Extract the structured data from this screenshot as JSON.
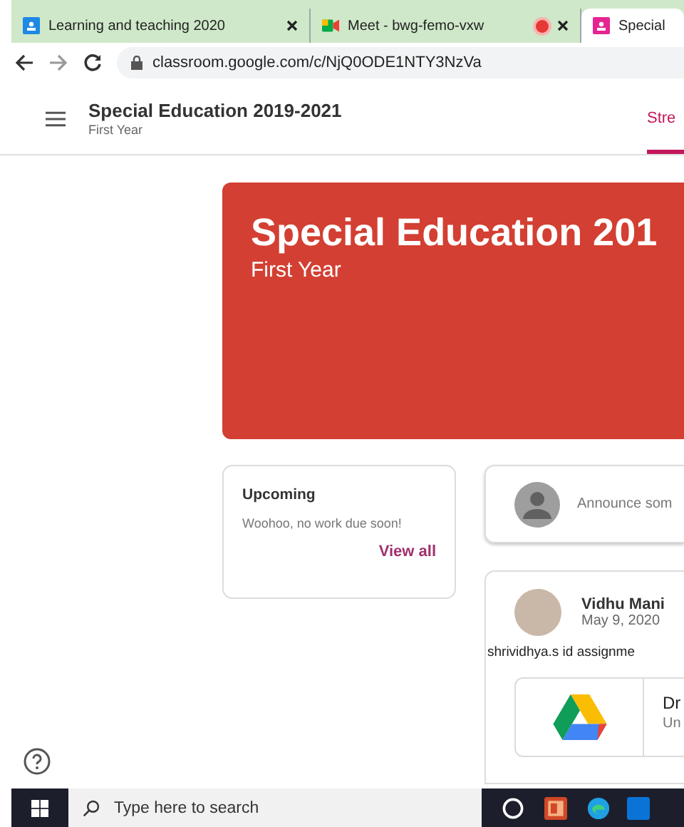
{
  "browser": {
    "tabs": [
      {
        "title": "Learning and teaching 2020",
        "selected": false,
        "recording": false
      },
      {
        "title": "Meet - bwg-femo-vxw",
        "selected": false,
        "recording": true
      },
      {
        "title": "Special",
        "selected": true,
        "recording": false
      }
    ],
    "url": "classroom.google.com/c/NjQ0ODE1NTY3NzVa"
  },
  "header": {
    "title": "Special Education 2019-2021",
    "subtitle": "First Year",
    "tab": "Stre"
  },
  "banner": {
    "title": "Special Education 201",
    "subtitle": "First Year"
  },
  "upcoming": {
    "title": "Upcoming",
    "message": "Woohoo, no work due soon!",
    "link": "View all"
  },
  "announce": {
    "placeholder": "Announce som"
  },
  "post": {
    "author": "Vidhu Mani",
    "date": "May 9, 2020",
    "text": "shrividhya.s id assignme",
    "attachment": {
      "title": "Dr",
      "subtitle": "Un"
    }
  },
  "taskbar": {
    "search_placeholder": "Type here to search"
  }
}
